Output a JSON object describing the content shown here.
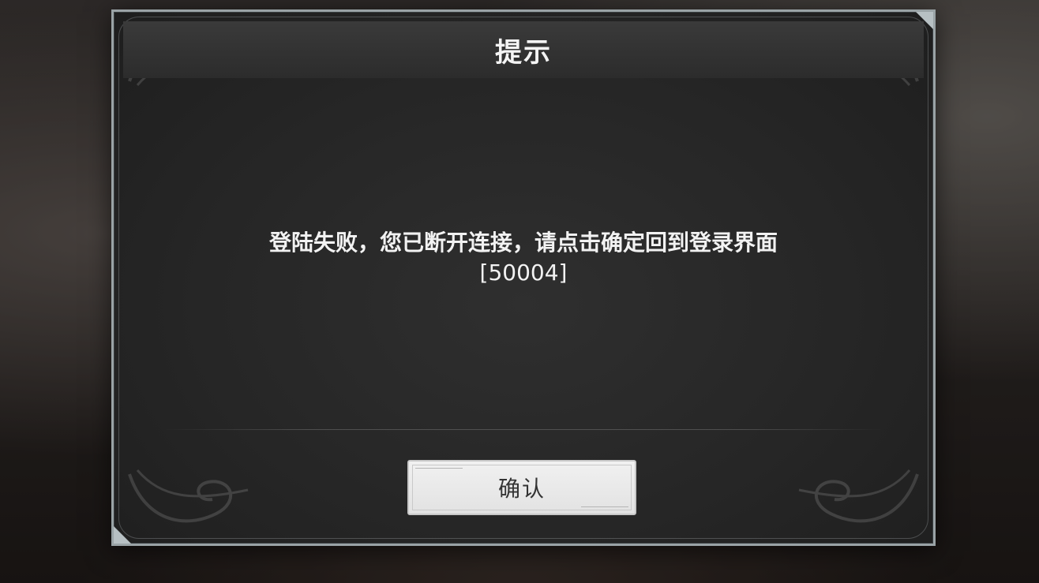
{
  "dialog": {
    "title": "提示",
    "message": "登陆失败，您已断开连接，请点击确定回到登录界面",
    "error_code": "[50004]",
    "confirm_label": "确认"
  },
  "colors": {
    "frame_border": "#9aa3a6",
    "panel_background": "#262626",
    "title_text": "#f4f4f4",
    "button_background": "#e9e9e9",
    "button_text": "#333333"
  },
  "icons": {
    "corner_ornaments": "ornamental-scroll-icon"
  }
}
